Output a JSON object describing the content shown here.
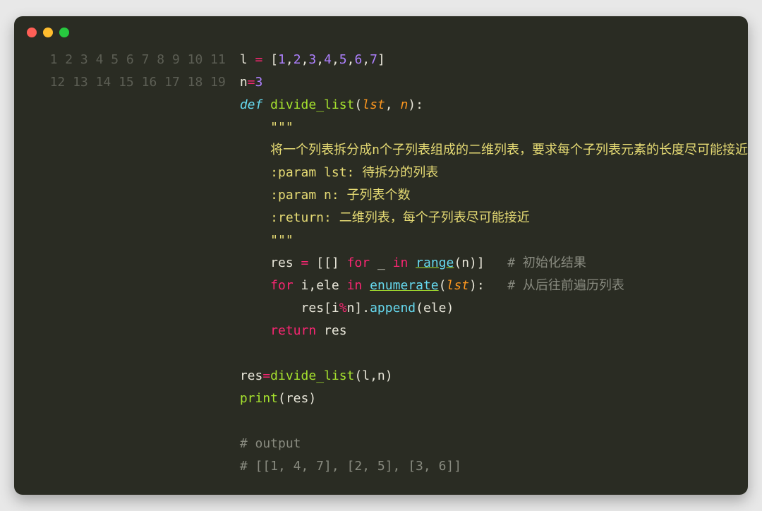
{
  "window": {
    "dots": [
      "red",
      "yellow",
      "green"
    ]
  },
  "gutter": {
    "start": 1,
    "end": 19
  },
  "code": {
    "l1": {
      "v1": "l",
      "op": "=",
      "b1": "[",
      "n1": "1",
      "c": ",",
      "n2": "2",
      "n3": "3",
      "n4": "4",
      "n5": "5",
      "n6": "6",
      "n7": "7",
      "b2": "]"
    },
    "l2": {
      "v1": "n",
      "op": "=",
      "n1": "3"
    },
    "l3": {
      "kw": "def",
      "fn": "divide_list",
      "p1": "lst",
      "p2": "n",
      "op1": "(",
      "op2": ",",
      "op3": ")",
      "op4": ":"
    },
    "l4": {
      "s": "    \"\"\""
    },
    "l5": {
      "s": "    将一个列表拆分成n个子列表组成的二维列表，要求每个子列表元素的长度尽可能接近"
    },
    "l6": {
      "s": "    :param lst: 待拆分的列表"
    },
    "l7": {
      "s": "    :param n: 子列表个数"
    },
    "l8": {
      "s": "    :return: 二维列表，每个子列表尽可能接近"
    },
    "l9": {
      "s": "    \"\"\""
    },
    "l10": {
      "v1": "res",
      "op": "=",
      "b1": "[[]",
      "kw": "for",
      "v2": "_",
      "kw2": "in",
      "fn": "range",
      "p": "n",
      "b2": ")]",
      "cm": "# 初始化结果"
    },
    "l11": {
      "kw": "for",
      "v1": "i",
      "c": ",",
      "v2": "ele",
      "kw2": "in",
      "fn": "enumerate",
      "p": "lst",
      "b": "):",
      "cm": "# 从后往前遍历列表"
    },
    "l12": {
      "v1": "res",
      "b1": "[",
      "v2": "i",
      "op": "%",
      "v3": "n",
      "b2": "].",
      "fn": "append",
      "b3": "(",
      "v4": "ele",
      "b4": ")"
    },
    "l13": {
      "kw": "return",
      "v": "res"
    },
    "l14": {
      "s": ""
    },
    "l15": {
      "v1": "res",
      "op": "=",
      "fn": "divide_list",
      "b1": "(",
      "v2": "l",
      "c": ",",
      "v3": "n",
      "b2": ")"
    },
    "l16": {
      "fn": "print",
      "b1": "(",
      "v": "res",
      "b2": ")"
    },
    "l17": {
      "s": ""
    },
    "l18": {
      "cm": "# output"
    },
    "l19": {
      "cm": "# [[1, 4, 7], [2, 5], [3, 6]]"
    }
  }
}
